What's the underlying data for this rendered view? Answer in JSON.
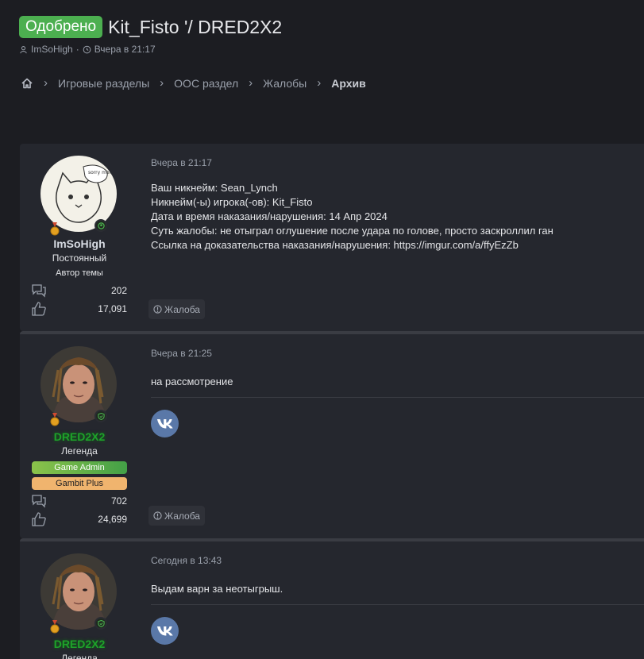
{
  "thread": {
    "status_badge": "Одобрено",
    "title": "Kit_Fisto '/ DRED2X2",
    "author": "ImSoHigh",
    "date": "Вчера в 21:17"
  },
  "breadcrumb": {
    "items": [
      "Игровые разделы",
      "OOC раздел",
      "Жалобы"
    ],
    "current": "Архив"
  },
  "posts": [
    {
      "user": {
        "name": "ImSoHigh",
        "title": "Постоянный",
        "author_tag": "Автор темы",
        "messages": "202",
        "reactions": "17,091"
      },
      "date": "Вчера в 21:17",
      "lines": [
        "Ваш никнейм: Sean_Lynch",
        "Никнейм(-ы) игрока(-ов): Kit_Fisto",
        "Дата и время наказания/нарушения: 14 Апр 2024",
        "Суть жалобы: не отыграл оглушение после удара по голове, просто заскроллил ган",
        "Ссылка на доказательства наказания/нарушения: https://imgur.com/a/ffyEzZb"
      ],
      "report_label": "Жалоба"
    },
    {
      "user": {
        "name": "DRED2X2",
        "title": "Легенда",
        "role1": "Game Admin",
        "role2": "Gambit Plus",
        "messages": "702",
        "reactions": "24,699"
      },
      "date": "Вчера в 21:25",
      "text": "на рассмотрение",
      "report_label": "Жалоба"
    },
    {
      "user": {
        "name": "DRED2X2",
        "title": "Легенда"
      },
      "date": "Сегодня в 13:43",
      "text": "Выдам варн за неотыгрыш."
    }
  ],
  "icons": {
    "user": "user-icon",
    "clock": "clock-icon",
    "home": "home-icon",
    "messages": "messages-icon",
    "reactions": "thumbs-up-icon",
    "report": "report-icon",
    "vk": "vk-icon"
  },
  "colors": {
    "approved": "#4caf50",
    "legend_name": "#1ea22a",
    "vk": "#5a78a8",
    "game_admin": "#66bb4a",
    "gambit_plus": "#f0b46e"
  }
}
